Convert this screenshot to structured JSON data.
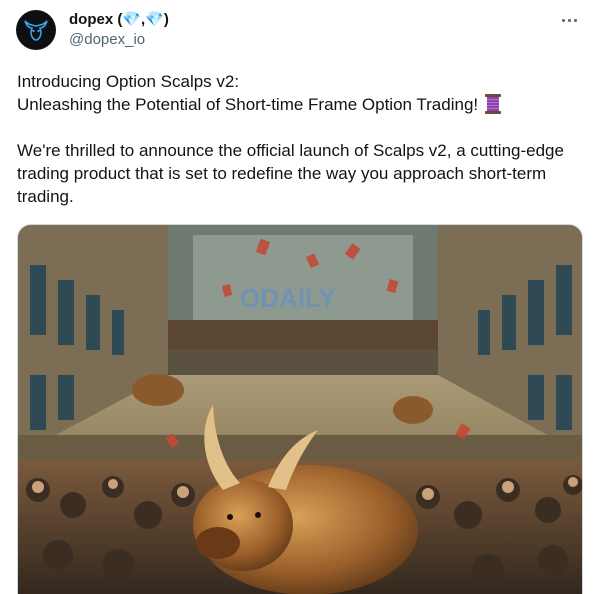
{
  "author": {
    "display_name": "dopex",
    "name_suffix_open": " (",
    "name_sep": ",",
    "name_suffix_close": ")",
    "gem_1": "💎",
    "gem_2": "💎",
    "handle": "@dopex_io",
    "avatar_icon": "bull-head-icon"
  },
  "menu": {
    "icon": "more-horizontal-icon"
  },
  "post": {
    "line_1": "Introducing Option Scalps v2:",
    "line_2": "Unleashing the Potential of Short-time Frame Option Trading!",
    "line_2_emoji_icon": "thread-spool-icon",
    "paragraph_2": "We're thrilled to announce the official launch of Scalps v2, a cutting-edge trading product that is set to redefine the way you approach short-term trading."
  },
  "media": {
    "image_icon": "bull-trading-floor-image",
    "watermark": "ODAILY"
  },
  "colors": {
    "text": "#0f1419",
    "secondary": "#536471",
    "accent": "#1d9bf0"
  }
}
